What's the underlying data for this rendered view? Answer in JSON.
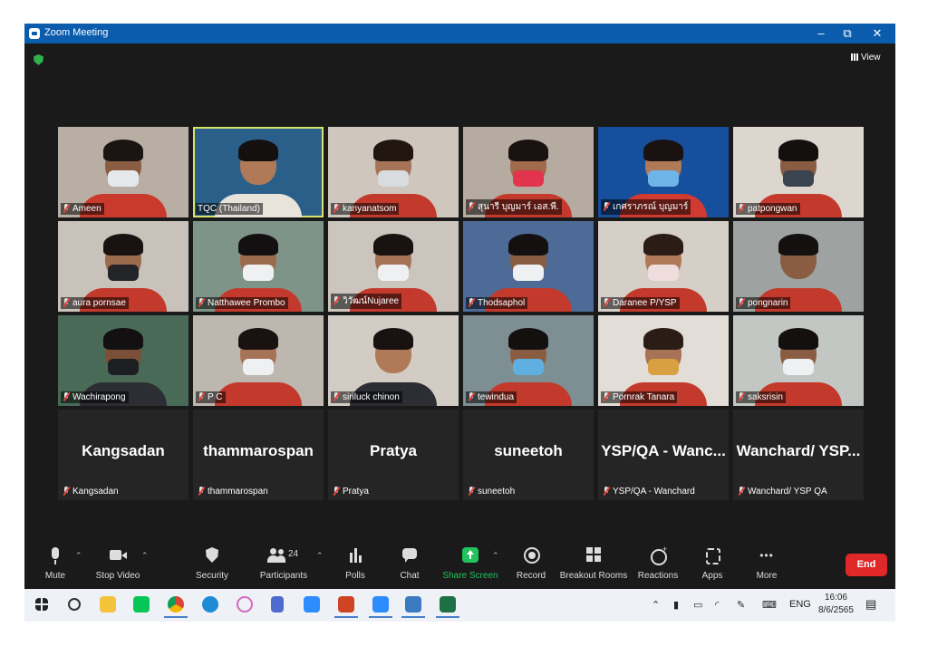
{
  "window": {
    "title": "Zoom Meeting",
    "controls": {
      "minimize": "–",
      "restore": "⧉",
      "close": "✕"
    },
    "view_label": "View"
  },
  "colors": {
    "titlebar": "#0b5cad",
    "speaking_border": "#d6e46b",
    "end_button": "#e02828",
    "share_green": "#22c25c"
  },
  "participants": [
    {
      "name": "Ameen",
      "bg": "#b8aea3",
      "skin": "#8a5d43",
      "hair": "#1a1412",
      "mask": "#e6e9ec",
      "shirt": "#c93a2c"
    },
    {
      "name": "TQC (Thailand)",
      "bg": "#2a5f8a",
      "skin": "#b07a58",
      "hair": "#141010",
      "mask": "none",
      "shirt": "#e8e4dc",
      "speaking": true
    },
    {
      "name": "kanyanatsom",
      "bg": "#cfc6bd",
      "skin": "#a77356",
      "hair": "#21150f",
      "mask": "#d9dcdf",
      "shirt": "#c33a2c"
    },
    {
      "name": "สุนารี บุญมาร์ เอส.พี.",
      "bg": "#b5aba0",
      "skin": "#a06a4c",
      "hair": "#1a1210",
      "mask": "#e2354d",
      "shirt": "#c33a2c"
    },
    {
      "name": "เกศราภรณ์ บุญมาร์",
      "bg": "#164f9c",
      "skin": "#b07a58",
      "hair": "#1a1210",
      "mask": "#6fb4e8",
      "shirt": "#d13a30"
    },
    {
      "name": "patpongwan",
      "bg": "#dcd6cf",
      "skin": "#8a5d43",
      "hair": "#151010",
      "mask": "#3a4350",
      "shirt": "#c33a2c"
    },
    {
      "name": "aura pornsae",
      "bg": "#c9c2ba",
      "skin": "#9b6b4d",
      "hair": "#1a1210",
      "mask": "#222428",
      "shirt": "#c33a2c"
    },
    {
      "name": "Natthawee Prombo",
      "bg": "#7f9489",
      "skin": "#9b6b4d",
      "hair": "#121010",
      "mask": "#eef0f2",
      "shirt": "#c33a2c"
    },
    {
      "name": "วิวัฒน์Nujaree",
      "bg": "#cbc5be",
      "skin": "#a77356",
      "hair": "#1a1210",
      "mask": "#eef0f2",
      "shirt": "#c33a2c"
    },
    {
      "name": "Thodsaphol",
      "bg": "#4e6a96",
      "skin": "#8a5d43",
      "hair": "#151010",
      "mask": "#eef0f2",
      "shirt": "#c33a2c"
    },
    {
      "name": "Daranee P/YSP",
      "bg": "#d6cfc8",
      "skin": "#b07a58",
      "hair": "#2b1d15",
      "mask": "#f0dede",
      "shirt": "#c33a2c"
    },
    {
      "name": "pongnarin",
      "bg": "#9ea3a2",
      "skin": "#8a5d43",
      "hair": "#151010",
      "mask": "none",
      "shirt": "#c33a2c"
    },
    {
      "name": "Wachirapong",
      "bg": "#4a6a58",
      "skin": "#7a5038",
      "hair": "#121010",
      "mask": "#1c1e22",
      "shirt": "#2c2e33"
    },
    {
      "name": "P C",
      "bg": "#bdb7b0",
      "skin": "#a77356",
      "hair": "#1a1210",
      "mask": "#eef0f2",
      "shirt": "#c33a2c"
    },
    {
      "name": "siriluck chinon",
      "bg": "#d2ccc5",
      "skin": "#b07a58",
      "hair": "#1a1210",
      "mask": "none",
      "shirt": "#2c2e33"
    },
    {
      "name": "tewindua",
      "bg": "#7d8f93",
      "skin": "#8a5d43",
      "hair": "#151010",
      "mask": "#5fb0e0",
      "shirt": "#c33a2c"
    },
    {
      "name": "Pornrak Tanara",
      "bg": "#e2ddd6",
      "skin": "#a77356",
      "hair": "#2b1d15",
      "mask": "#d8a040",
      "shirt": "#c33a2c"
    },
    {
      "name": "saksrisin",
      "bg": "#c3c7c4",
      "skin": "#8a5d43",
      "hair": "#151010",
      "mask": "#eef0f2",
      "shirt": "#c33a2c"
    },
    {
      "name": "Kangsadan",
      "big": "Kangsadan"
    },
    {
      "name": "thammarospan",
      "big": "thammarospan"
    },
    {
      "name": "Pratya",
      "big": "Pratya"
    },
    {
      "name": "suneetoh",
      "big": "suneetoh"
    },
    {
      "name": "YSP/QA - Wanchard",
      "big": "YSP/QA - Wanc..."
    },
    {
      "name": "Wanchard/ YSP QA",
      "big": "Wanchard/ YSP..."
    }
  ],
  "toolbar": {
    "mute": "Mute",
    "stop_video": "Stop Video",
    "security": "Security",
    "participants": "Participants",
    "participants_count": "24",
    "polls": "Polls",
    "chat": "Chat",
    "share_screen": "Share Screen",
    "record": "Record",
    "breakout_rooms": "Breakout Rooms",
    "reactions": "Reactions",
    "apps": "Apps",
    "more": "More",
    "end": "End"
  },
  "taskbar": {
    "apps": [
      "windows-start-icon",
      "search-icon",
      "file-explorer-icon",
      "line-icon",
      "chrome-icon",
      "edge-icon",
      "pinwheel-icon",
      "calculator-icon",
      "zoom-icon",
      "powerpoint-icon",
      "zoom-meeting-icon",
      "photos-icon",
      "excel-icon"
    ],
    "language": "ENG",
    "time": "16:06",
    "date": "8/6/2565"
  }
}
